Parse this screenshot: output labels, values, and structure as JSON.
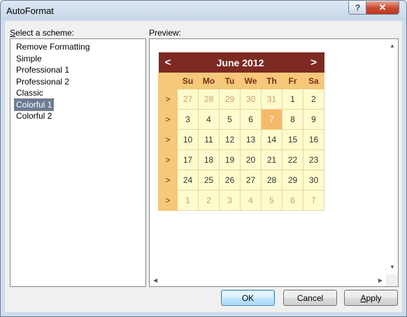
{
  "window": {
    "title": "AutoFormat",
    "help_label": "?",
    "close_label": "✕"
  },
  "scheme_label": {
    "first": "S",
    "rest": "elect a scheme:"
  },
  "schemes": [
    "Remove Formatting",
    "Simple",
    "Professional 1",
    "Professional 2",
    "Classic",
    "Colorful 1",
    "Colorful 2"
  ],
  "selected_scheme": "Colorful 1",
  "preview_label": "Preview:",
  "calendar": {
    "title": "June 2012",
    "prev": "<",
    "next": ">",
    "selector": ">",
    "days_of_week": [
      "Su",
      "Mo",
      "Tu",
      "We",
      "Th",
      "Fr",
      "Sa"
    ],
    "weeks": [
      [
        "27",
        "28",
        "29",
        "30",
        "31",
        "1",
        "2"
      ],
      [
        "3",
        "4",
        "5",
        "6",
        "7",
        "8",
        "9"
      ],
      [
        "10",
        "11",
        "12",
        "13",
        "14",
        "15",
        "16"
      ],
      [
        "17",
        "18",
        "19",
        "20",
        "21",
        "22",
        "23"
      ],
      [
        "24",
        "25",
        "26",
        "27",
        "28",
        "29",
        "30"
      ],
      [
        "1",
        "2",
        "3",
        "4",
        "5",
        "6",
        "7"
      ]
    ],
    "today": "7"
  },
  "buttons": {
    "ok": "OK",
    "cancel": "Cancel",
    "apply": {
      "first": "A",
      "rest": "pply"
    }
  },
  "colors": {
    "title_bg": "#7d2a22",
    "dow_bg": "#f5c87a",
    "day_bg": "#fffbcc",
    "today_bg": "#f6b96a",
    "selection": "#6b7b94"
  }
}
